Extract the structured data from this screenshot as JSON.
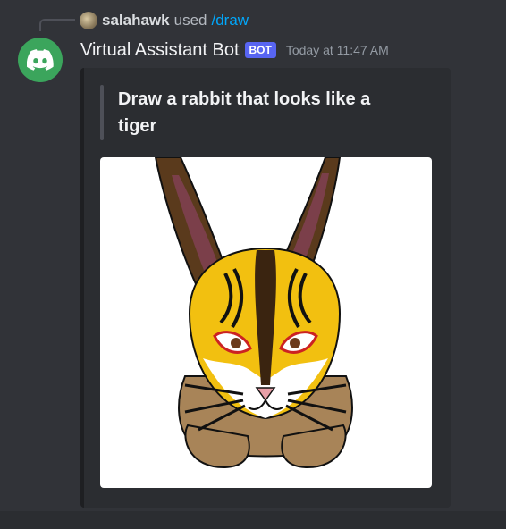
{
  "reply": {
    "username": "salahawk",
    "used_text": "used",
    "command": "/draw"
  },
  "message": {
    "bot_name": "Virtual Assistant Bot",
    "bot_tag": "BOT",
    "timestamp": "Today at 11:47 AM"
  },
  "embed": {
    "prompt": "Draw a rabbit that looks like a tiger",
    "image_icon": "rabbit-tiger-drawing"
  },
  "colors": {
    "background": "#313338",
    "embed_background": "#2b2d31",
    "avatar": "#3ba55c",
    "bot_tag": "#5865f2",
    "command_link": "#00a8fc"
  }
}
